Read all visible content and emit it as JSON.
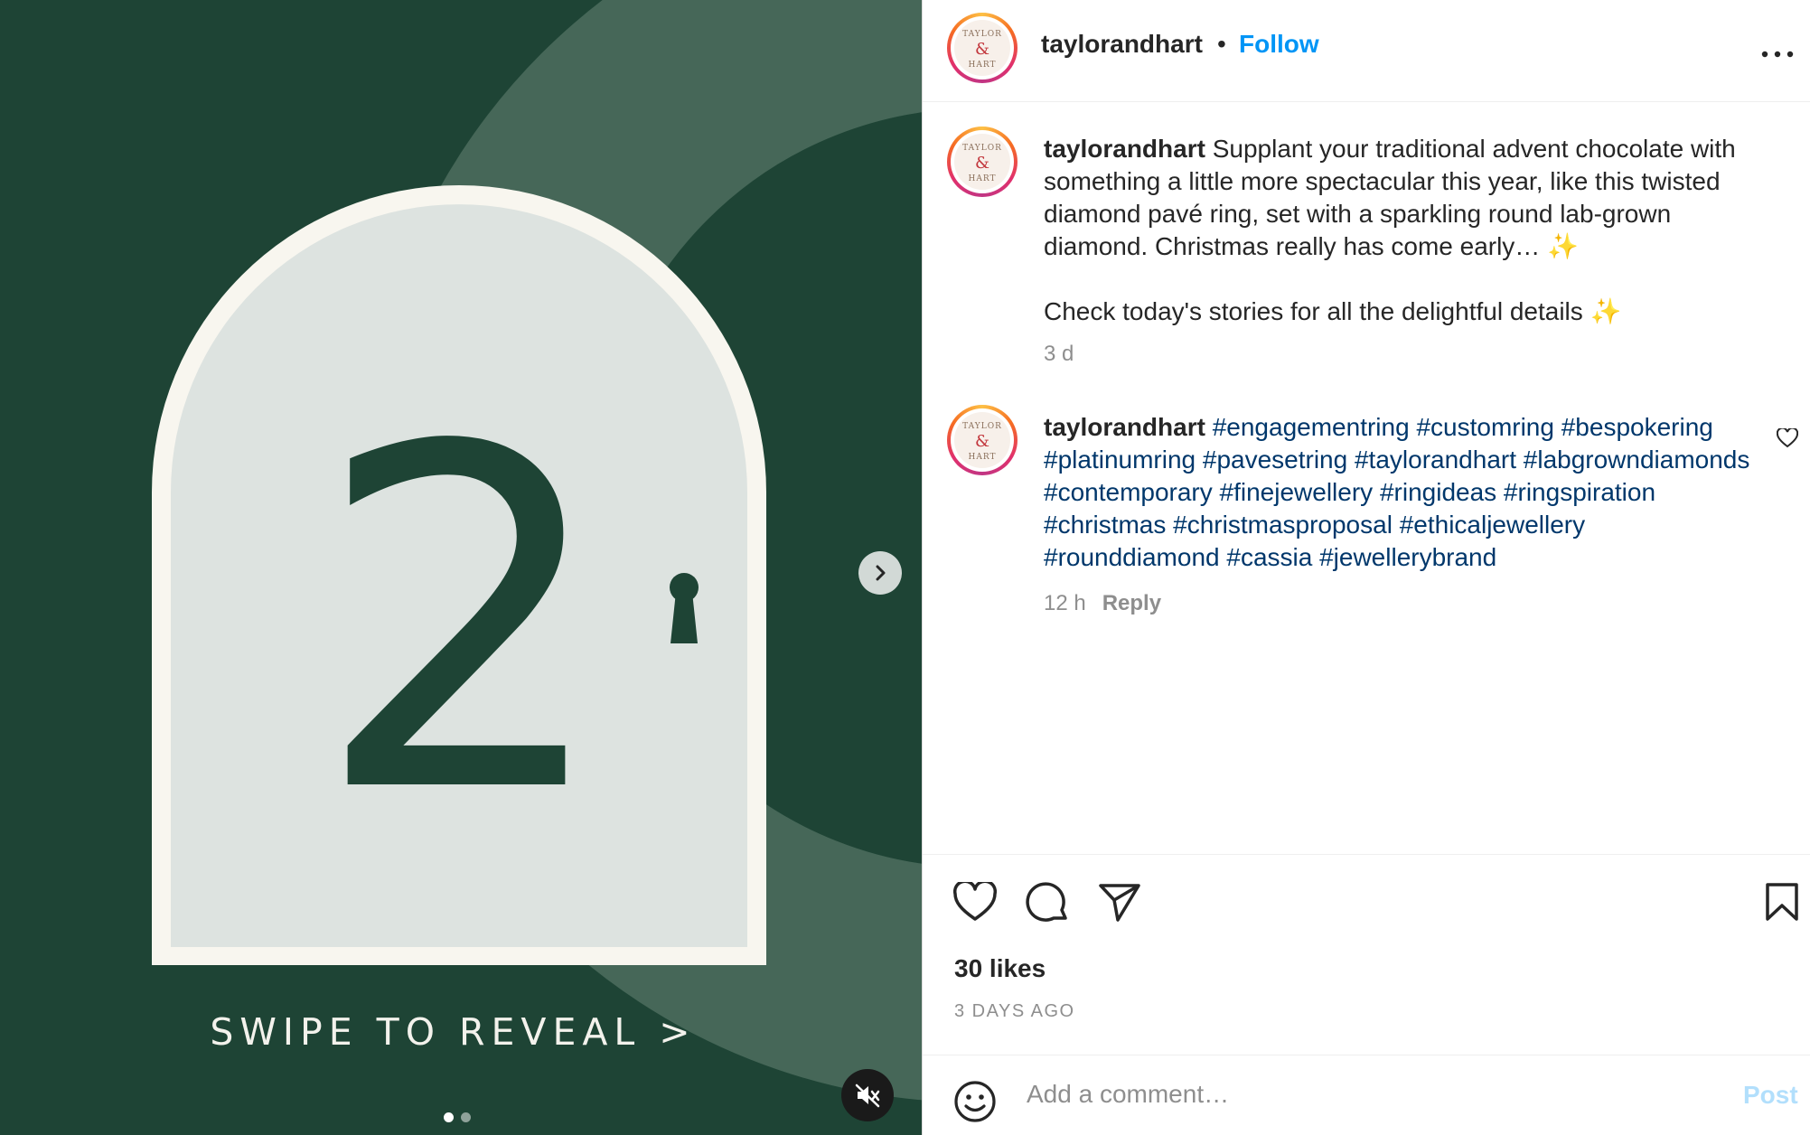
{
  "media": {
    "door_number": "2",
    "swipe_text": "SWIPE TO REVEAL >",
    "slide_count": 2,
    "active_slide": 1,
    "colors": {
      "background": "#1e4435",
      "door": "#dde3e0",
      "door_frame": "#f8f6ef",
      "number": "#1e4435"
    }
  },
  "header": {
    "username": "taylorandhart",
    "separator": "•",
    "follow_label": "Follow",
    "more_label": "•••"
  },
  "caption": {
    "username": "taylorandhart",
    "text": "Supplant your traditional advent chocolate with something a little more spectacular this year, like this twisted diamond pavé ring, set with a sparkling round lab-grown diamond. Christmas really has come early… ✨",
    "text2": "Check today's stories for all the delightful details ✨",
    "time": "3 d"
  },
  "comment": {
    "username": "taylorandhart",
    "hashtags": "#engagementring #customring #bespokering #platinumring #pavesetring #taylorandhart #labgrowndiamonds #contemporary #finejewellery #ringideas #ringspiration #christmas #christmasproposal #ethicaljewellery #rounddiamond #cassia #jewellerybrand",
    "time": "12 h",
    "reply_label": "Reply"
  },
  "footer": {
    "likes": "30 likes",
    "date": "3 DAYS AGO",
    "comment_placeholder": "Add a comment…",
    "post_label": "Post"
  },
  "logo_text": {
    "top": "TAYLOR",
    "amp": "&",
    "bottom": "HART"
  },
  "accent_colors": {
    "follow": "#0095f6",
    "hashtag": "#00376b",
    "muted": "#8e8e8e"
  }
}
